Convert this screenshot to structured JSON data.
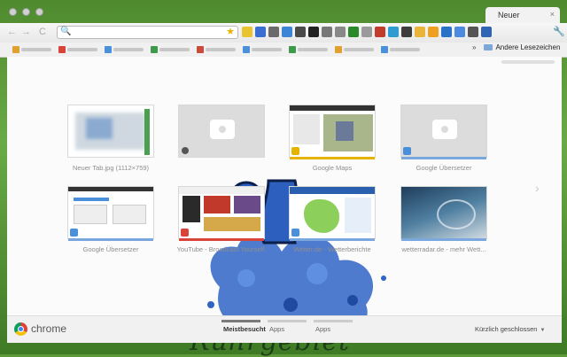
{
  "window": {
    "tab_title": "Neuer",
    "tab_close": "×"
  },
  "toolbar": {
    "back": "←",
    "forward": "→",
    "reload": "C",
    "omnibox_value": "",
    "search_glyph": "🔍",
    "star_glyph": "★",
    "menu_glyph": "🔧",
    "extensions": [
      {
        "name": "ext-1",
        "color": "#e9c430"
      },
      {
        "name": "ext-2",
        "color": "#3a6fd1"
      },
      {
        "name": "ext-3",
        "color": "#6b6b6b"
      },
      {
        "name": "ext-4",
        "color": "#3b84d6"
      },
      {
        "name": "ext-5",
        "color": "#4a4a4a"
      },
      {
        "name": "ext-6",
        "color": "#222222"
      },
      {
        "name": "ext-7",
        "color": "#777777"
      },
      {
        "name": "ext-8",
        "color": "#888888"
      },
      {
        "name": "ext-9",
        "color": "#2a8a2a"
      },
      {
        "name": "ext-10",
        "color": "#9a9a9a"
      },
      {
        "name": "ext-11",
        "color": "#c23b2b"
      },
      {
        "name": "ext-12",
        "color": "#2f9bd0"
      },
      {
        "name": "ext-13",
        "color": "#3d3d3d"
      },
      {
        "name": "ext-14",
        "color": "#e8b43a"
      },
      {
        "name": "ext-15",
        "color": "#f0a020"
      },
      {
        "name": "ext-16",
        "color": "#2a72c8"
      },
      {
        "name": "ext-17",
        "color": "#4b8ae0"
      },
      {
        "name": "ext-18",
        "color": "#555555"
      },
      {
        "name": "ext-19",
        "color": "#3064b5"
      }
    ]
  },
  "bookmarks": {
    "other_label": "Andere Lesezeichen",
    "chevron": "»",
    "items": [
      {
        "color": "#e0a030"
      },
      {
        "color": "#d9443a"
      },
      {
        "color": "#4a8fd9"
      },
      {
        "color": "#3d9a4a"
      },
      {
        "color": "#c74a3a"
      },
      {
        "color": "#4a8fd9"
      },
      {
        "color": "#3d9a4a"
      },
      {
        "color": "#e0a030"
      },
      {
        "color": "#4a8fd9"
      }
    ]
  },
  "most_visited": [
    {
      "label": "Neuer Tab.jpg (1112×759)",
      "type": "image"
    },
    {
      "label": "",
      "type": "placeholder"
    },
    {
      "label": "Google Maps",
      "type": "maps"
    },
    {
      "label": "Google Übersetzer",
      "type": "placeholder"
    },
    {
      "label": "Google Übersetzer",
      "type": "translate"
    },
    {
      "label": "YouTube - Broadcast Yourself.",
      "type": "youtube"
    },
    {
      "label": "Wetter.de - Wetterberichte",
      "type": "weather"
    },
    {
      "label": "wetterradar.de - mehr Wett...",
      "type": "radar"
    }
  ],
  "theme": {
    "overlay_text": "Ruhrgebiet"
  },
  "bottom_bar": {
    "brand": "chrome",
    "sections": [
      {
        "label": "Meistbesucht",
        "active": true
      },
      {
        "label": "Apps",
        "active": false
      },
      {
        "label": "Apps",
        "active": false
      }
    ],
    "recently_closed": "Kürzlich geschlossen",
    "recently_arrow": "▼"
  },
  "next_arrow": "›"
}
